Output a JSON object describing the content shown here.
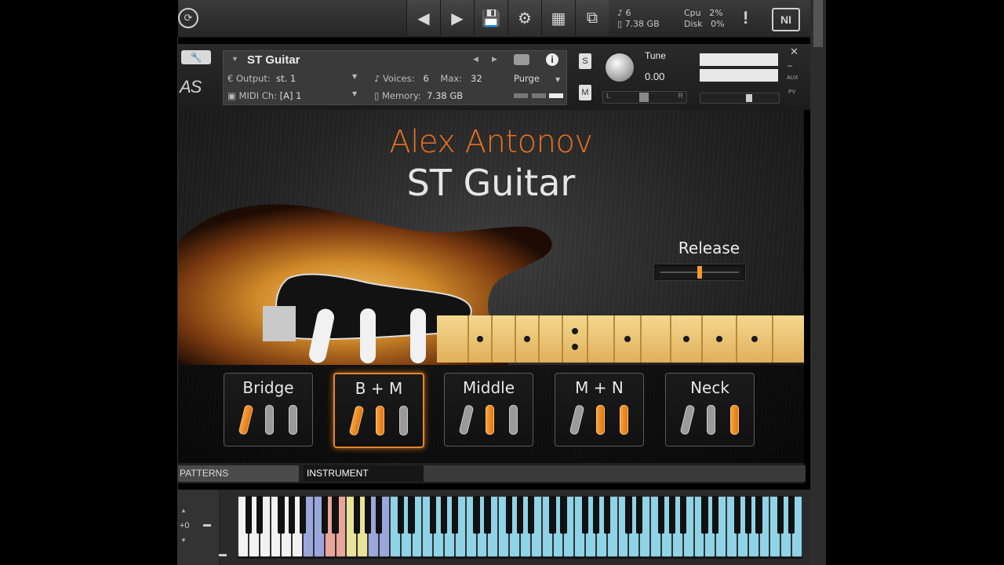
{
  "topbar": {
    "voices_count": "6",
    "memory": "7.38 GB",
    "cpu_label": "Cpu",
    "cpu_value": "2%",
    "disk_label": "Disk",
    "disk_value": "0%",
    "warning": "!",
    "ni_logo": "NI"
  },
  "instrument": {
    "name": "ST Guitar",
    "output_label": "Output:",
    "output_value": "st. 1",
    "voices_label": "Voices:",
    "voices_value": "6",
    "max_label": "Max:",
    "max_value": "32",
    "purge_label": "Purge",
    "midi_label": "MIDI Ch:",
    "midi_value": "[A]  1",
    "memory_label": "Memory:",
    "memory_value": "7.38 GB",
    "tune_label": "Tune",
    "tune_value": "0.00",
    "solo": "S",
    "mute": "M",
    "aux": "AUX",
    "pv": "PV",
    "pan_left": "L",
    "pan_right": "R"
  },
  "panel": {
    "brand": "Alex Antonov",
    "product": "ST Guitar",
    "release_label": "Release",
    "release_level": 0.5
  },
  "pickups": [
    {
      "label": "Bridge",
      "states": [
        true,
        false,
        false
      ],
      "active": false
    },
    {
      "label": "B + M",
      "states": [
        true,
        true,
        false
      ],
      "active": true
    },
    {
      "label": "Middle",
      "states": [
        false,
        true,
        false
      ],
      "active": false
    },
    {
      "label": "M + N",
      "states": [
        false,
        true,
        true
      ],
      "active": false
    },
    {
      "label": "Neck",
      "states": [
        false,
        false,
        true
      ],
      "active": false
    }
  ],
  "tabs": {
    "patterns": "PATTERNS",
    "instrument": "INSTRUMENT"
  },
  "keyboard": {
    "octave": "+0"
  },
  "colors": {
    "accent": "#e8701f",
    "pickup_on": "#f39a2b",
    "key_blue": "#8fd3e6",
    "key_red": "#e9a59a",
    "key_yellow": "#e9e39a",
    "key_purple": "#9ba6dc"
  }
}
